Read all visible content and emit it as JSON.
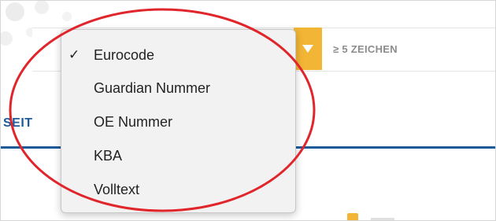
{
  "search": {
    "placeholder": "≥ 5 ZEICHEN",
    "type_options": [
      {
        "label": "Eurocode",
        "selected": true
      },
      {
        "label": "Guardian Nummer",
        "selected": false
      },
      {
        "label": "OE Nummer",
        "selected": false
      },
      {
        "label": "KBA",
        "selected": false
      },
      {
        "label": "Volltext",
        "selected": false
      }
    ],
    "check_mark": "✓"
  },
  "tabs": {
    "partial_label": "SEIT"
  },
  "colors": {
    "accent": "#f2b535",
    "brand_blue": "#1c5a9a",
    "annotation_red": "#e0252b",
    "menu_bg": "#f2f2f2"
  },
  "icons": {
    "dropdown": "caret-down-icon",
    "selected": "checkmark-icon"
  }
}
